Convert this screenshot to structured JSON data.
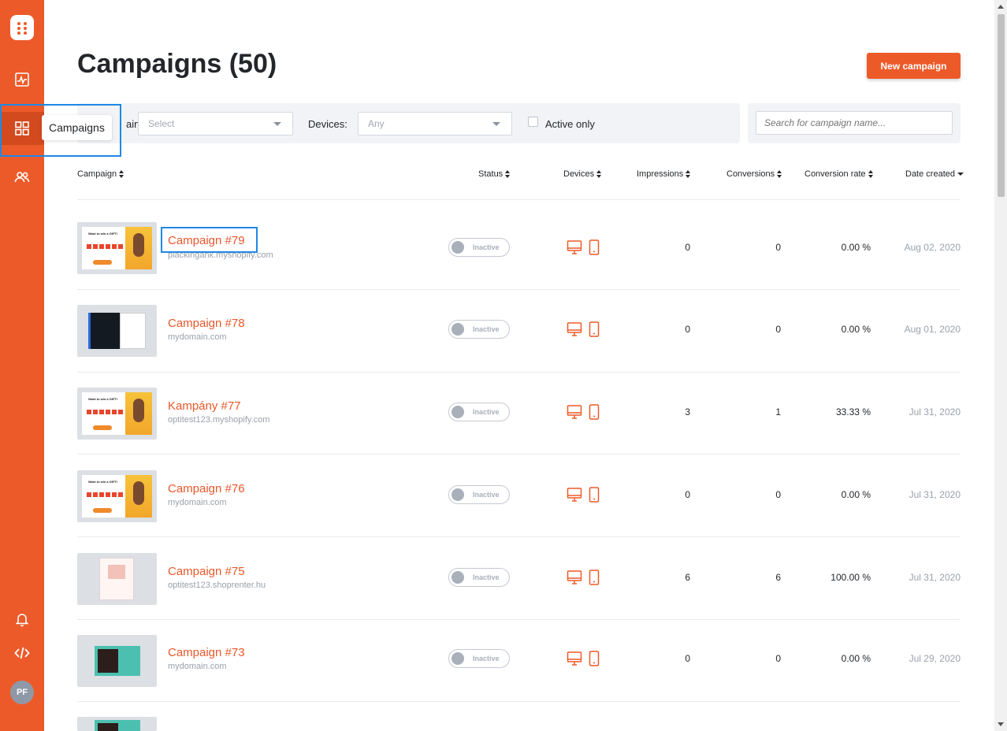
{
  "colors": {
    "brand": "#ed5a29",
    "link": "#e9572a",
    "highlight": "#1e88e5"
  },
  "sidebar": {
    "items": [
      {
        "name": "logo-icon"
      },
      {
        "name": "analytics-icon"
      },
      {
        "name": "campaigns-icon",
        "active": true
      },
      {
        "name": "users-icon"
      },
      {
        "name": "bell-icon"
      },
      {
        "name": "code-icon"
      }
    ],
    "avatar": "PF",
    "tooltip": "Campaigns"
  },
  "header": {
    "title": "Campaigns (50)",
    "new_button": "New campaign"
  },
  "filters": {
    "domain_label": "ain:",
    "domain_placeholder": "Select",
    "devices_label": "Devices:",
    "devices_value": "Any",
    "active_only_label": "Active only",
    "search_placeholder": "Search for campaign name..."
  },
  "table": {
    "columns": [
      "Campaign",
      "Status",
      "Devices",
      "Impressions",
      "Conversions",
      "Conversion rate",
      "Date created"
    ],
    "rows": [
      {
        "name": "Campaign #79",
        "domain": "plackingank.myshopify.com",
        "status": "Inactive",
        "impressions": "0",
        "conversions": "0",
        "rate": "0.00 %",
        "date": "Aug 02, 2020",
        "thumb": "gift"
      },
      {
        "name": "Campaign #78",
        "domain": "mydomain.com",
        "status": "Inactive",
        "impressions": "0",
        "conversions": "0",
        "rate": "0.00 %",
        "date": "Aug 01, 2020",
        "thumb": "dark"
      },
      {
        "name": "Kampány #77",
        "domain": "optitest123.myshopify.com",
        "status": "Inactive",
        "impressions": "3",
        "conversions": "1",
        "rate": "33.33 %",
        "date": "Jul 31, 2020",
        "thumb": "gift"
      },
      {
        "name": "Campaign #76",
        "domain": "mydomain.com",
        "status": "Inactive",
        "impressions": "0",
        "conversions": "0",
        "rate": "0.00 %",
        "date": "Jul 31, 2020",
        "thumb": "gift"
      },
      {
        "name": "Campaign #75",
        "domain": "optitest123.shoprenter.hu",
        "status": "Inactive",
        "impressions": "6",
        "conversions": "6",
        "rate": "100.00 %",
        "date": "Jul 31, 2020",
        "thumb": "pink"
      },
      {
        "name": "Campaign #73",
        "domain": "mydomain.com",
        "status": "Inactive",
        "impressions": "0",
        "conversions": "0",
        "rate": "0.00 %",
        "date": "Jul 29, 2020",
        "thumb": "xmas"
      }
    ]
  }
}
